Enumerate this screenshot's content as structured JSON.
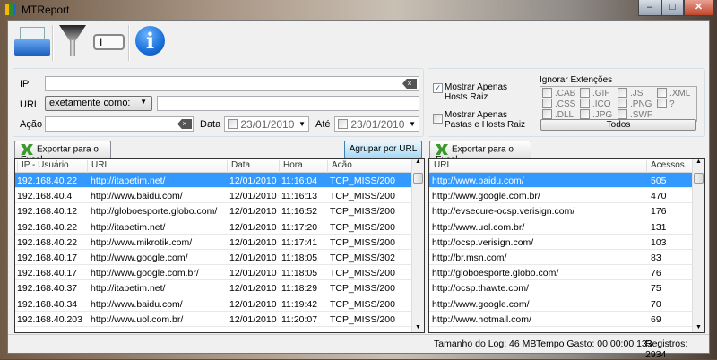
{
  "window": {
    "title": "MTReport",
    "controls": {
      "minimize": "–",
      "maximize": "□",
      "close": "✕"
    }
  },
  "toolbar": {
    "items": [
      {
        "icon": "open-folder-icon"
      },
      {
        "icon": "filter-funnel-icon"
      },
      {
        "icon": "textbox-icon"
      },
      {
        "icon": "info-icon",
        "glyph": "i"
      }
    ]
  },
  "filters": {
    "ip_label": "IP",
    "ip_value": "",
    "url_label": "URL",
    "url_match": "exetamente como:",
    "url_value": "",
    "acao_label": "Ação",
    "acao_value": "",
    "data_label": "Data",
    "data_value": "23/01/2010",
    "ate_label": "Até",
    "ate_value": "23/01/2010"
  },
  "options": {
    "hosts_raiz": {
      "label": "Mostrar Apenas Hosts Raiz",
      "checked": true
    },
    "pastas_hosts": {
      "label": "Mostrar Apenas Pastas e Hosts Raiz",
      "checked": false
    },
    "ignore_title": "Ignorar Extenções",
    "extensions": [
      ".CAB",
      ".GIF",
      ".JS",
      ".XML",
      ".CSS",
      ".ICO",
      ".PNG",
      "?",
      ".DLL",
      ".JPG",
      ".SWF"
    ],
    "todos_label": "Todos"
  },
  "left": {
    "export_label": "Exportar para o Excel",
    "group_label": "Agrupar por URL",
    "columns": [
      "IP - Usuário",
      "URL",
      "Data",
      "Hora",
      "Acão"
    ],
    "rows": [
      [
        "192.168.40.22",
        "http://itapetim.net/",
        "12/01/2010",
        "11:16:04",
        "TCP_MISS/200"
      ],
      [
        "192.168.40.4",
        "http://www.baidu.com/",
        "12/01/2010",
        "11:16:13",
        "TCP_MISS/200"
      ],
      [
        "192.168.40.12",
        "http://globoesporte.globo.com/",
        "12/01/2010",
        "11:16:52",
        "TCP_MISS/200"
      ],
      [
        "192.168.40.22",
        "http://itapetim.net/",
        "12/01/2010",
        "11:17:20",
        "TCP_MISS/200"
      ],
      [
        "192.168.40.22",
        "http://www.mikrotik.com/",
        "12/01/2010",
        "11:17:41",
        "TCP_MISS/200"
      ],
      [
        "192.168.40.17",
        "http://www.google.com/",
        "12/01/2010",
        "11:18:05",
        "TCP_MISS/302"
      ],
      [
        "192.168.40.17",
        "http://www.google.com.br/",
        "12/01/2010",
        "11:18:05",
        "TCP_MISS/200"
      ],
      [
        "192.168.40.37",
        "http://itapetim.net/",
        "12/01/2010",
        "11:18:29",
        "TCP_MISS/200"
      ],
      [
        "192.168.40.34",
        "http://www.baidu.com/",
        "12/01/2010",
        "11:19:42",
        "TCP_MISS/200"
      ],
      [
        "192.168.40.203",
        "http://www.uol.com.br/",
        "12/01/2010",
        "11:20:07",
        "TCP_MISS/200"
      ]
    ]
  },
  "right": {
    "export_label": "Exportar para o Excel",
    "columns": [
      "URL",
      "Acessos"
    ],
    "rows": [
      [
        "http://www.baidu.com/",
        "505"
      ],
      [
        "http://www.google.com.br/",
        "470"
      ],
      [
        "http://evsecure-ocsp.verisign.com/",
        "176"
      ],
      [
        "http://www.uol.com.br/",
        "131"
      ],
      [
        "http://ocsp.verisign.com/",
        "103"
      ],
      [
        "http://br.msn.com/",
        "83"
      ],
      [
        "http://globoesporte.globo.com/",
        "76"
      ],
      [
        "http://ocsp.thawte.com/",
        "75"
      ],
      [
        "http://www.google.com/",
        "70"
      ],
      [
        "http://www.hotmail.com/",
        "69"
      ]
    ]
  },
  "status": {
    "log_size": "Tamanho do Log: 46 MB",
    "time": "Tempo Gasto: 00:00:00.133",
    "records": "Registros: 2934"
  },
  "colors": {
    "selection": "#3399ff",
    "info": "#1a6fd8"
  }
}
